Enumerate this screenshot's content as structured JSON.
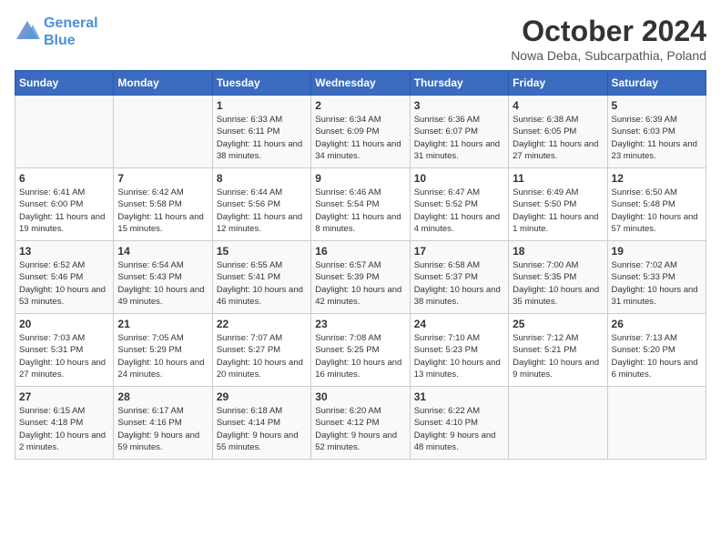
{
  "header": {
    "logo_line1": "General",
    "logo_line2": "Blue",
    "month": "October 2024",
    "location": "Nowa Deba, Subcarpathia, Poland"
  },
  "days_of_week": [
    "Sunday",
    "Monday",
    "Tuesday",
    "Wednesday",
    "Thursday",
    "Friday",
    "Saturday"
  ],
  "weeks": [
    [
      {
        "day": "",
        "info": ""
      },
      {
        "day": "",
        "info": ""
      },
      {
        "day": "1",
        "info": "Sunrise: 6:33 AM\nSunset: 6:11 PM\nDaylight: 11 hours and 38 minutes."
      },
      {
        "day": "2",
        "info": "Sunrise: 6:34 AM\nSunset: 6:09 PM\nDaylight: 11 hours and 34 minutes."
      },
      {
        "day": "3",
        "info": "Sunrise: 6:36 AM\nSunset: 6:07 PM\nDaylight: 11 hours and 31 minutes."
      },
      {
        "day": "4",
        "info": "Sunrise: 6:38 AM\nSunset: 6:05 PM\nDaylight: 11 hours and 27 minutes."
      },
      {
        "day": "5",
        "info": "Sunrise: 6:39 AM\nSunset: 6:03 PM\nDaylight: 11 hours and 23 minutes."
      }
    ],
    [
      {
        "day": "6",
        "info": "Sunrise: 6:41 AM\nSunset: 6:00 PM\nDaylight: 11 hours and 19 minutes."
      },
      {
        "day": "7",
        "info": "Sunrise: 6:42 AM\nSunset: 5:58 PM\nDaylight: 11 hours and 15 minutes."
      },
      {
        "day": "8",
        "info": "Sunrise: 6:44 AM\nSunset: 5:56 PM\nDaylight: 11 hours and 12 minutes."
      },
      {
        "day": "9",
        "info": "Sunrise: 6:46 AM\nSunset: 5:54 PM\nDaylight: 11 hours and 8 minutes."
      },
      {
        "day": "10",
        "info": "Sunrise: 6:47 AM\nSunset: 5:52 PM\nDaylight: 11 hours and 4 minutes."
      },
      {
        "day": "11",
        "info": "Sunrise: 6:49 AM\nSunset: 5:50 PM\nDaylight: 11 hours and 1 minute."
      },
      {
        "day": "12",
        "info": "Sunrise: 6:50 AM\nSunset: 5:48 PM\nDaylight: 10 hours and 57 minutes."
      }
    ],
    [
      {
        "day": "13",
        "info": "Sunrise: 6:52 AM\nSunset: 5:46 PM\nDaylight: 10 hours and 53 minutes."
      },
      {
        "day": "14",
        "info": "Sunrise: 6:54 AM\nSunset: 5:43 PM\nDaylight: 10 hours and 49 minutes."
      },
      {
        "day": "15",
        "info": "Sunrise: 6:55 AM\nSunset: 5:41 PM\nDaylight: 10 hours and 46 minutes."
      },
      {
        "day": "16",
        "info": "Sunrise: 6:57 AM\nSunset: 5:39 PM\nDaylight: 10 hours and 42 minutes."
      },
      {
        "day": "17",
        "info": "Sunrise: 6:58 AM\nSunset: 5:37 PM\nDaylight: 10 hours and 38 minutes."
      },
      {
        "day": "18",
        "info": "Sunrise: 7:00 AM\nSunset: 5:35 PM\nDaylight: 10 hours and 35 minutes."
      },
      {
        "day": "19",
        "info": "Sunrise: 7:02 AM\nSunset: 5:33 PM\nDaylight: 10 hours and 31 minutes."
      }
    ],
    [
      {
        "day": "20",
        "info": "Sunrise: 7:03 AM\nSunset: 5:31 PM\nDaylight: 10 hours and 27 minutes."
      },
      {
        "day": "21",
        "info": "Sunrise: 7:05 AM\nSunset: 5:29 PM\nDaylight: 10 hours and 24 minutes."
      },
      {
        "day": "22",
        "info": "Sunrise: 7:07 AM\nSunset: 5:27 PM\nDaylight: 10 hours and 20 minutes."
      },
      {
        "day": "23",
        "info": "Sunrise: 7:08 AM\nSunset: 5:25 PM\nDaylight: 10 hours and 16 minutes."
      },
      {
        "day": "24",
        "info": "Sunrise: 7:10 AM\nSunset: 5:23 PM\nDaylight: 10 hours and 13 minutes."
      },
      {
        "day": "25",
        "info": "Sunrise: 7:12 AM\nSunset: 5:21 PM\nDaylight: 10 hours and 9 minutes."
      },
      {
        "day": "26",
        "info": "Sunrise: 7:13 AM\nSunset: 5:20 PM\nDaylight: 10 hours and 6 minutes."
      }
    ],
    [
      {
        "day": "27",
        "info": "Sunrise: 6:15 AM\nSunset: 4:18 PM\nDaylight: 10 hours and 2 minutes."
      },
      {
        "day": "28",
        "info": "Sunrise: 6:17 AM\nSunset: 4:16 PM\nDaylight: 9 hours and 59 minutes."
      },
      {
        "day": "29",
        "info": "Sunrise: 6:18 AM\nSunset: 4:14 PM\nDaylight: 9 hours and 55 minutes."
      },
      {
        "day": "30",
        "info": "Sunrise: 6:20 AM\nSunset: 4:12 PM\nDaylight: 9 hours and 52 minutes."
      },
      {
        "day": "31",
        "info": "Sunrise: 6:22 AM\nSunset: 4:10 PM\nDaylight: 9 hours and 48 minutes."
      },
      {
        "day": "",
        "info": ""
      },
      {
        "day": "",
        "info": ""
      }
    ]
  ]
}
